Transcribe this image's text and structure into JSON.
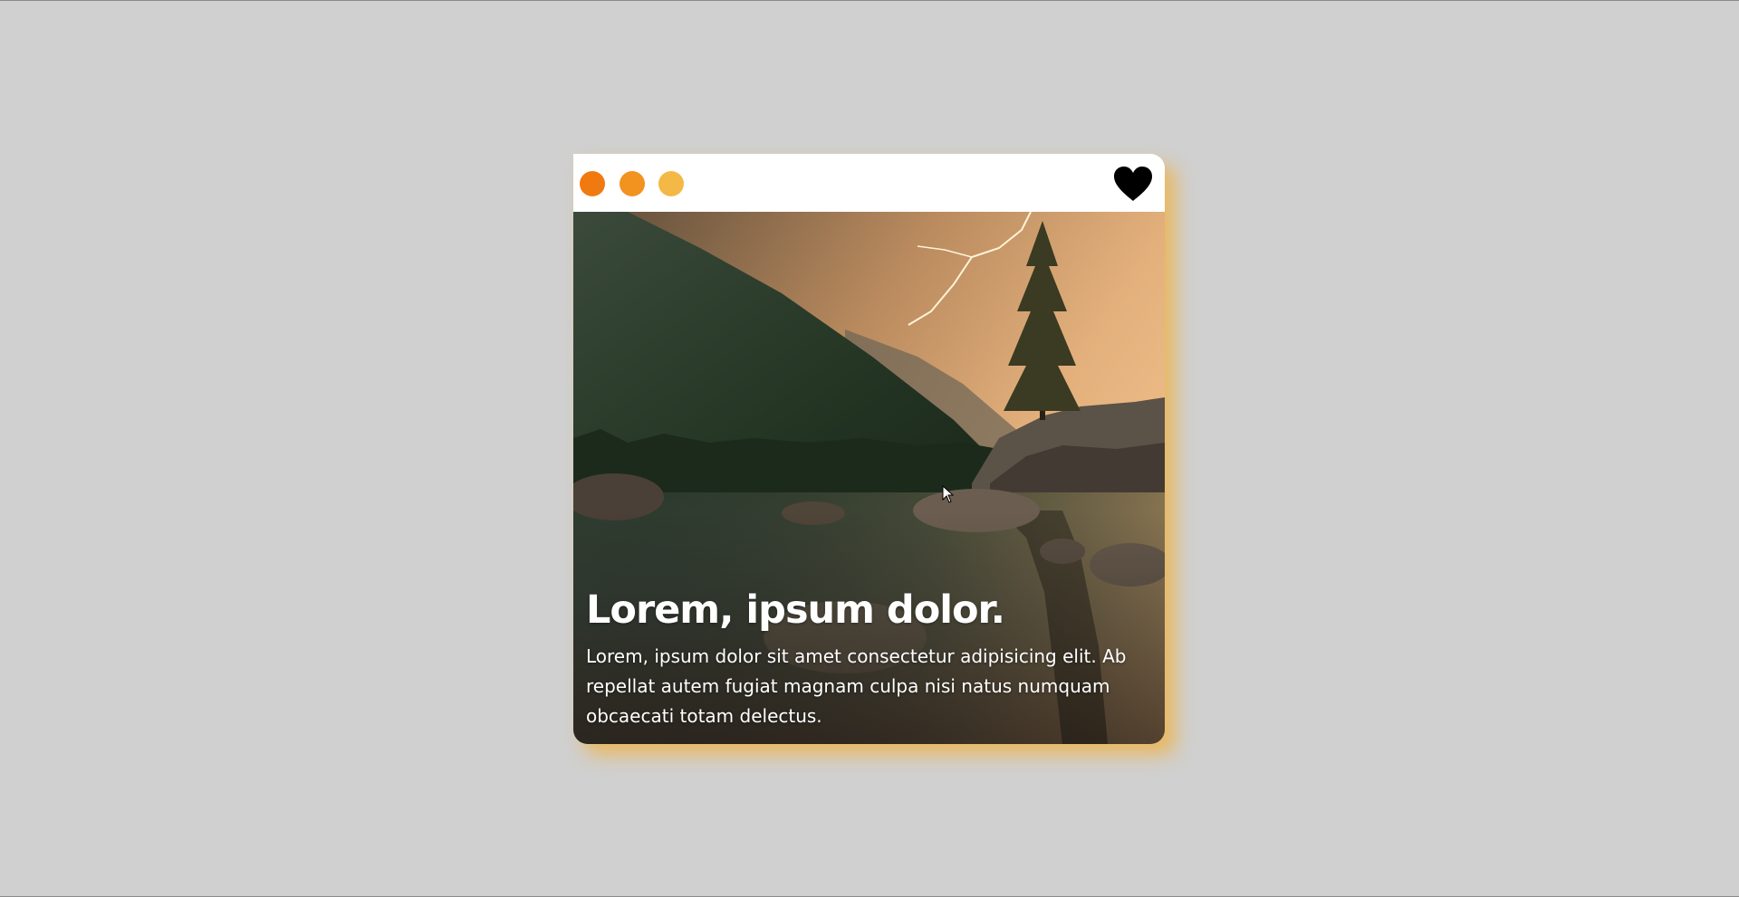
{
  "card": {
    "title": "Lorem, ipsum dolor.",
    "description": "Lorem, ipsum dolor sit amet consectetur adipisicing elit. Ab repellat autem fugiat magnam culpa nisi natus numquam obcaecati totam delectus.",
    "header": {
      "dots": [
        {
          "color": "#f07a10"
        },
        {
          "color": "#f2921f"
        },
        {
          "color": "#f4b846"
        }
      ],
      "favorite_icon": "heart-icon"
    },
    "image_icon": "landscape-image",
    "shadow_color": "#f0b03c"
  },
  "page": {
    "background": "#d0d0d0"
  }
}
